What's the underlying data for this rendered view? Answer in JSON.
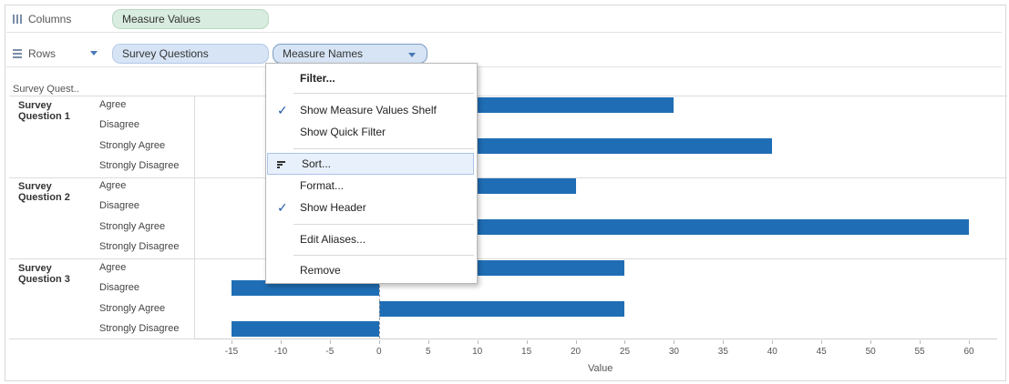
{
  "shelves": {
    "columns": {
      "label": "Columns",
      "pills": [
        "Measure Values"
      ]
    },
    "rows": {
      "label": "Rows",
      "pills": [
        "Survey Questions",
        "Measure Names"
      ]
    }
  },
  "view": {
    "header_title": "Survey Quest..",
    "groups": [
      {
        "name": "Survey Question 1",
        "line1": "Survey",
        "line2": "Question 1"
      },
      {
        "name": "Survey Question 2",
        "line1": "Survey",
        "line2": "Question 2"
      },
      {
        "name": "Survey Question 3",
        "line1": "Survey",
        "line2": "Question 3"
      }
    ],
    "categories": [
      "Agree",
      "Disagree",
      "Strongly Agree",
      "Strongly Disagree"
    ],
    "axis_title": "Value"
  },
  "chart_data": {
    "type": "bar",
    "orientation": "horizontal",
    "groups": [
      "Survey Question 1",
      "Survey Question 2",
      "Survey Question 3"
    ],
    "categories": [
      "Agree",
      "Disagree",
      "Strongly Agree",
      "Strongly Disagree"
    ],
    "series": [
      {
        "group": "Survey Question 1",
        "values": [
          30,
          null,
          40,
          null
        ]
      },
      {
        "group": "Survey Question 2",
        "values": [
          20,
          null,
          60,
          null
        ]
      },
      {
        "group": "Survey Question 3",
        "values": [
          25,
          -15,
          25,
          -15
        ]
      }
    ],
    "xlabel": "Value",
    "xlim": [
      -15,
      60
    ],
    "xticks": [
      -15,
      -10,
      -5,
      0,
      5,
      10,
      15,
      20,
      25,
      30,
      35,
      40,
      45,
      50,
      55,
      60
    ],
    "bar_color": "#1f6eb5"
  },
  "menu": {
    "items": [
      {
        "label": "Filter...",
        "checked": false,
        "bold": true
      },
      {
        "label": "Show Measure Values Shelf",
        "checked": true
      },
      {
        "label": "Show Quick Filter",
        "checked": false
      },
      {
        "label": "Sort...",
        "checked": false,
        "icon": "sort-icon",
        "highlighted": true
      },
      {
        "label": "Format...",
        "checked": false
      },
      {
        "label": "Show Header",
        "checked": true
      },
      {
        "label": "Edit Aliases...",
        "checked": false
      },
      {
        "label": "Remove",
        "checked": false
      }
    ]
  }
}
